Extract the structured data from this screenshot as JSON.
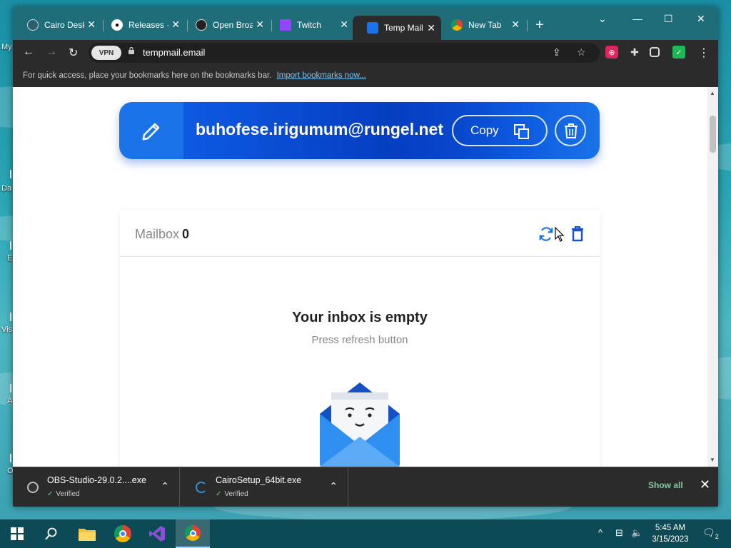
{
  "desktop": {
    "labels": [
      "My",
      "Da",
      "E",
      "Vis",
      "A",
      "O"
    ]
  },
  "browser": {
    "tabs": [
      {
        "label": "Cairo Desktop",
        "icon": "cairo-icon"
      },
      {
        "label": "Releases · ",
        "icon": "github-icon"
      },
      {
        "label": "Open Broadcaster",
        "icon": "obs-icon"
      },
      {
        "label": "Twitch",
        "icon": "twitch-icon"
      },
      {
        "label": "Temp Mail",
        "icon": "tempmail-icon",
        "active": true
      },
      {
        "label": "New Tab",
        "icon": "chrome-icon"
      }
    ],
    "new_tab": "+",
    "url": "tempmail.email",
    "vpn_label": "VPN",
    "bookmarks_text": "For quick access, place your bookmarks here on the bookmarks bar.",
    "bookmarks_link": "Import bookmarks now..."
  },
  "page": {
    "email": "buhofese.irigumum@rungel.net",
    "copy_label": "Copy",
    "mailbox_label": "Mailbox",
    "mailbox_count": "0",
    "empty_title": "Your inbox is empty",
    "empty_subtitle": "Press refresh button",
    "accent_color": "#1a73e8"
  },
  "downloads": {
    "items": [
      {
        "name": "OBS-Studio-29.0.2....exe",
        "status": "Verified"
      },
      {
        "name": "CairoSetup_64bit.exe",
        "status": "Verified"
      }
    ],
    "show_all": "Show all"
  },
  "taskbar": {
    "time": "5:45 AM",
    "date": "3/15/2023",
    "notifications": "2"
  }
}
